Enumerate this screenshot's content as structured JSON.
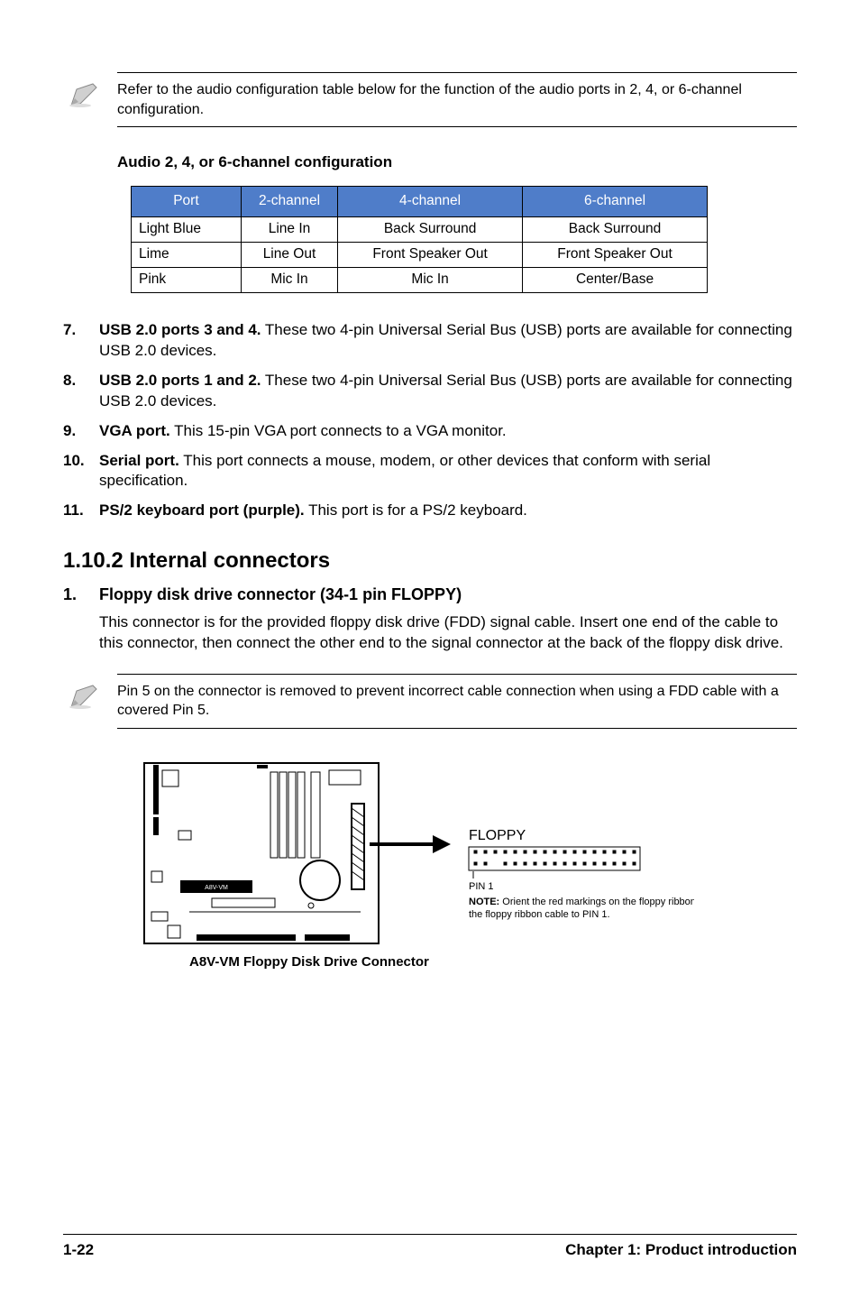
{
  "top_note": "Refer to the audio configuration table below for the function of the audio ports in 2, 4, or 6-channel configuration.",
  "table_title": "Audio 2, 4, or 6-channel configuration",
  "table_headers": {
    "c0": "Port",
    "c1": "2-channel",
    "c2": "4-channel",
    "c3": "6-channel"
  },
  "table_rows": [
    {
      "c0": "Light Blue",
      "c1": "Line In",
      "c2": "Back Surround",
      "c3": "Back Surround"
    },
    {
      "c0": "Lime",
      "c1": "Line Out",
      "c2": "Front Speaker Out",
      "c3": "Front Speaker Out"
    },
    {
      "c0": "Pink",
      "c1": "Mic In",
      "c2": "Mic In",
      "c3": "Center/Base"
    }
  ],
  "items": {
    "i7": {
      "num": "7.",
      "lead": "USB 2.0 ports 3 and 4.",
      "text": " These two 4-pin Universal Serial Bus (USB) ports are available for connecting USB 2.0 devices."
    },
    "i8": {
      "num": "8.",
      "lead": "USB 2.0 ports 1 and 2.",
      "text": " These two 4-pin Universal Serial Bus (USB) ports are available for connecting USB 2.0 devices."
    },
    "i9": {
      "num": "9.",
      "lead": "VGA port.",
      "text": " This 15-pin VGA port connects to a VGA monitor."
    },
    "i10": {
      "num": "10.",
      "lead": "Serial port.",
      "text": " This port connects a mouse, modem, or other devices that conform with serial specification."
    },
    "i11": {
      "num": "11.",
      "lead": "PS/2 keyboard port (purple).",
      "text": " This port is for a PS/2 keyboard."
    }
  },
  "section_title": "1.10.2 Internal connectors",
  "sub1": {
    "num": "1.",
    "title": "Floppy disk drive connector (34-1 pin FLOPPY)",
    "body": "This connector is for the provided floppy disk drive (FDD) signal cable. Insert one end of the cable to this connector, then connect the other end to the signal connector at the back of the floppy disk drive."
  },
  "pin_note": "Pin 5 on the connector is removed to prevent incorrect cable connection when using a FDD cable with a covered Pin 5.",
  "diagram": {
    "caption": "A8V-VM Floppy Disk Drive Connector",
    "floppy_label": "FLOPPY",
    "pin_label": "PIN 1",
    "note_lead": "NOTE:",
    "note_text": " Orient the red markings on the floppy ribbon cable to PIN 1.",
    "board_label": "A8V-VM"
  },
  "footer": {
    "page": "1-22",
    "chapter": "Chapter 1: Product introduction"
  }
}
